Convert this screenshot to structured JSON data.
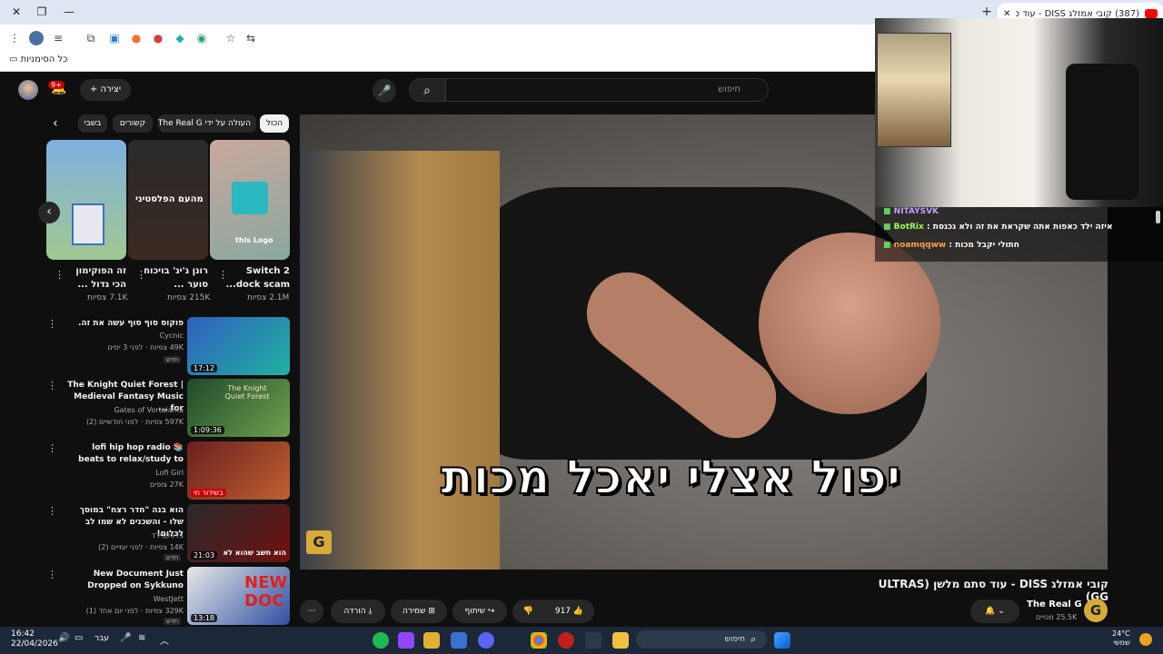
{
  "browser": {
    "tab_title": "(387) קובי אמזלג DISS - עוד סתם...",
    "bookmarks_all": "כל הסימניות"
  },
  "youtube": {
    "search_placeholder": "חיפוש",
    "create_label": "יצירה",
    "notif_count": "9+",
    "chips": [
      "הכול",
      "העולה על ידי The Real G",
      "קשורים",
      "בשבי"
    ],
    "shorts": [
      {
        "title": "Switch 2 dock scam...",
        "views": "2.1M צפיות",
        "overlay": "this Logo"
      },
      {
        "title": "רונן ג'יג' בויכוח סוער ...",
        "views": "215K צפיות",
        "overlay": "מהעם הפלסטיני"
      },
      {
        "title": "זה הפוקימון הכי גדול ...",
        "views": "7.1K צפיות"
      }
    ],
    "recs": [
      {
        "title": "פוקוס סוף סוף עשה את זה.",
        "channel": "Cycnic",
        "meta": "49K צפיות · לפני 3 ימים",
        "badge": "חדש",
        "duration": "17:12"
      },
      {
        "title": "The Knight Quiet Forest | Medieval Fantasy Music for ...",
        "channel": "Gates of Vortalania",
        "meta": "597K צפיות · לפני חודשיים (2)",
        "duration": "1:09:36",
        "thumb_text": "The Knight Quiet Forest"
      },
      {
        "title": "lofi hip hop radio 📚 beats to relax/study to",
        "channel": "Lofi Girl",
        "meta": "27K צופים",
        "live": "בשידור חי"
      },
      {
        "title": "הוא בנה \"חדר רצח\" במוסך שלו - והשכנים לא שמו לב לכלום!",
        "channel": "בלאקבירד",
        "meta": "14K צפיות · לפני יומיים (2)",
        "badge": "חדש",
        "duration": "21:03",
        "thumb_text": "הוא חשב שהוא לא"
      },
      {
        "title": "New Document Just Dropped on Sykkuno",
        "channel": "WestJett",
        "meta": "329K צפיות · לפני יום אחד (1)",
        "badge": "חדש",
        "duration": "13:18",
        "thumb_text": "NEW DOC"
      }
    ],
    "video": {
      "overlay_text": "יפול אצלי יאכל מכות",
      "title": "קובי אמזלג DISS - עוד סתם מלשן (ULTRAS GG)",
      "channel": "The Real G",
      "subs": "25.5K מנויים",
      "likes": "917",
      "share": "שיתוף",
      "save": "שמירה",
      "download": "הורדה"
    }
  },
  "chat": [
    {
      "user": "NITAYSVK",
      "text": ""
    },
    {
      "user": "BotRix",
      "text": "איזה ילד כאפות אתה שקראת את זה ולא נכנסת"
    },
    {
      "user": "noamqqww",
      "text": "חתולי יקבל מכות"
    }
  ],
  "taskbar": {
    "time": "16:42",
    "date": "22/04/2026",
    "lang": "עבר",
    "search": "חיפוש",
    "temp": "24°C",
    "weather": "שמשי"
  }
}
